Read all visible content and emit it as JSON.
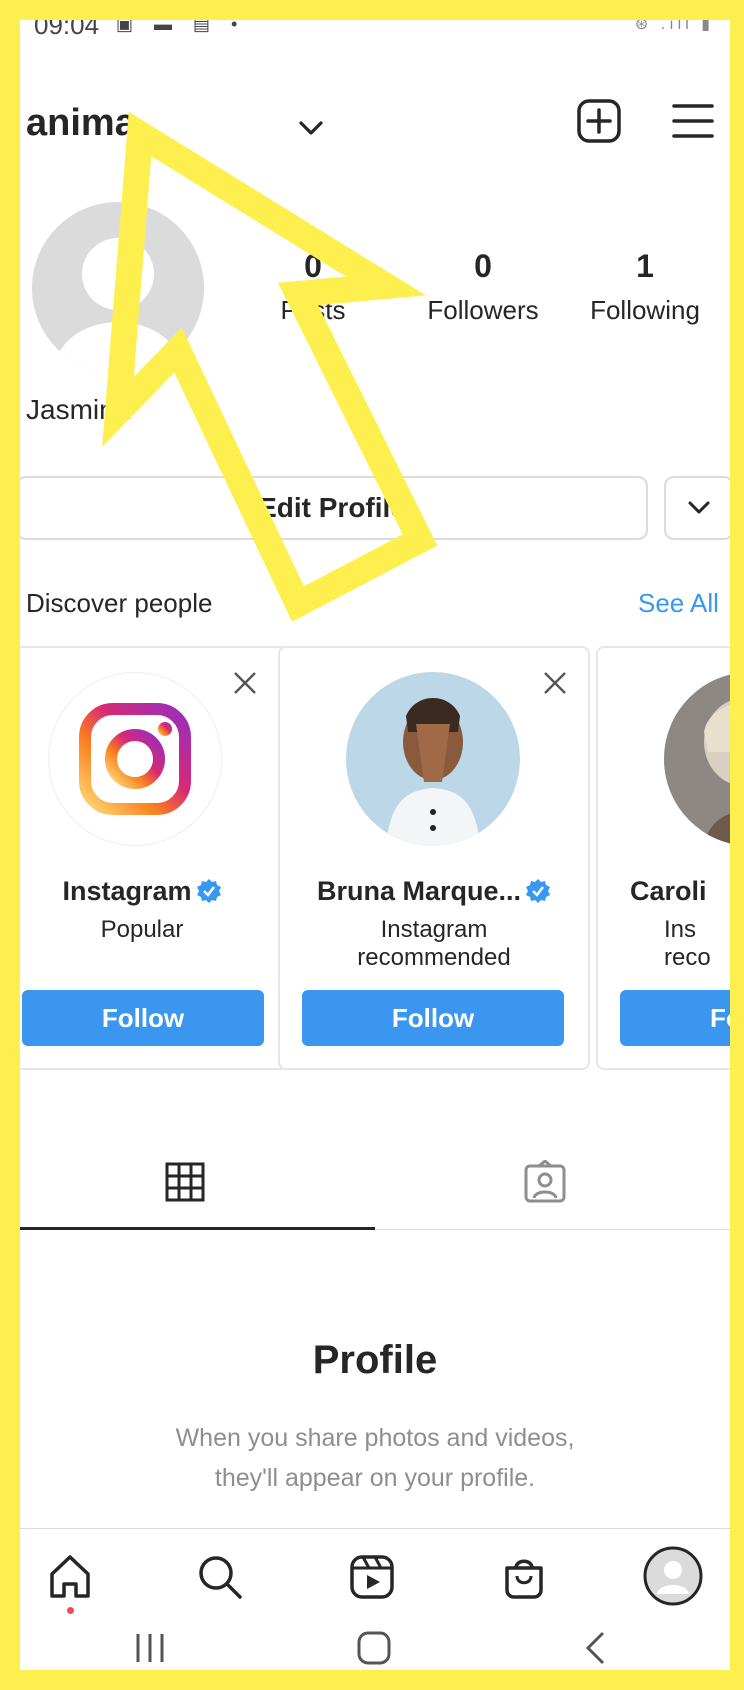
{
  "status_bar": {
    "time": "09:04",
    "icons": "▣ ▬ ▤ •",
    "right": "⊛ .ıll ▮"
  },
  "header": {
    "username": "anima"
  },
  "profile": {
    "posts_count": "0",
    "posts_label": "Posts",
    "followers_count": "0",
    "followers_label": "Followers",
    "following_count": "1",
    "following_label": "Following",
    "full_name": "Jasmina"
  },
  "edit_profile_label": "Edit Profile",
  "discover": {
    "title": "Discover people",
    "see_all": "See All",
    "cards": [
      {
        "name": "Instagram",
        "subtitle": "Popular",
        "follow": "Follow"
      },
      {
        "name": "Bruna Marque...",
        "subtitle": "Instagram recommended",
        "follow": "Follow"
      },
      {
        "name": "Caroli",
        "subtitle": "Ins reco",
        "follow": "Fo"
      }
    ]
  },
  "empty_state": {
    "title": "Profile",
    "description": "When you share photos and videos, they'll appear on your profile."
  },
  "colors": {
    "accent": "#3a96ee",
    "highlight": "#fdf04e",
    "link": "#3897f0"
  }
}
